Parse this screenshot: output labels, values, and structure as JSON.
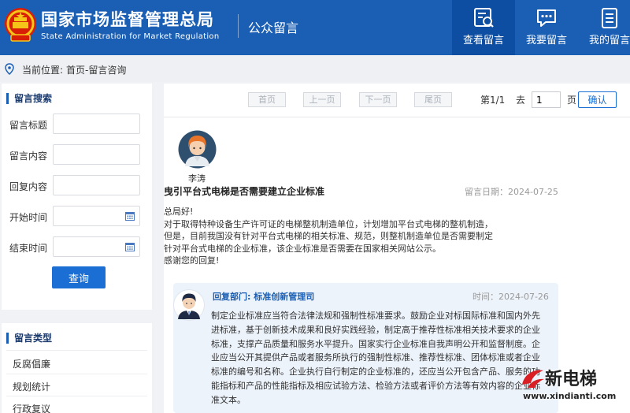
{
  "header": {
    "title_cn": "国家市场监督管理总局",
    "title_en": "State Administration for Market Regulation",
    "section": "公众留言",
    "nav": [
      {
        "label": "查看留言",
        "active": true
      },
      {
        "label": "我要留言",
        "active": false
      },
      {
        "label": "我的留言",
        "active": false
      }
    ],
    "colors": {
      "brand": "#1a5fb4",
      "active_tab": "#0e4ea2"
    }
  },
  "breadcrumb": {
    "label": "当前位置:",
    "path": "首页-留言咨询"
  },
  "search": {
    "heading": "留言搜索",
    "fields": [
      {
        "label": "留言标题",
        "value": ""
      },
      {
        "label": "留言内容",
        "value": ""
      },
      {
        "label": "回复内容",
        "value": ""
      },
      {
        "label": "开始时间",
        "value": ""
      },
      {
        "label": "结束时间",
        "value": ""
      }
    ],
    "submit_label": "查询"
  },
  "types": {
    "heading": "留言类型",
    "items": [
      "反腐倡廉",
      "规划统计",
      "行政复议"
    ]
  },
  "pager": {
    "first": "首页",
    "prev": "上一页",
    "next": "下一页",
    "last": "尾页",
    "page_info": "第1/1",
    "goto_prefix": "去",
    "goto_value": "1",
    "goto_suffix": "页",
    "confirm_label": "确认"
  },
  "message": {
    "author": "李涛",
    "title": "曳引平台式电梯是否需要建立企业标准",
    "date": "留言日期：2024-07-25",
    "body_lines": [
      "总局好!",
      "对于取得特种设备生产许可证的电梯整机制造单位，计划增加平台式电梯的整机制造，",
      "但是，目前我国没有针对平台式电梯的相关标准、规范，则整机制造单位是否需要制定",
      "针对平台式电梯的企业标准，该企业标准是否需要在国家相关网站公示。",
      "感谢您的回复!"
    ]
  },
  "reply": {
    "dept": "回复部门: 标准创新管理司",
    "date": "时间：2024-07-26",
    "body_lines": [
      "制定企业标准应当符合法律法规和强制性标准要求。鼓励企业对标国际标准和国内外先",
      "进标准，基于创新技术成果和良好实践经验，制定高于推荐性标准相关技术要求的企业",
      "标准，支撑产品质量和服务水平提升。国家实行企业标准自我声明公开和监督制度。企",
      "业应当公开其提供产品或者服务所执行的强制性标准、推荐性标准、团体标准或者企业",
      "标准的编号和名称。企业执行自行制定的企业标准的，还应当公开包含产品、服务的功",
      "能指标和产品的性能指标及相应试验方法、检验方法或者评价方法等有效内容的企业标",
      "准文本。"
    ]
  },
  "watermark": {
    "text": "新电梯",
    "url": "www.xindianti.com"
  }
}
